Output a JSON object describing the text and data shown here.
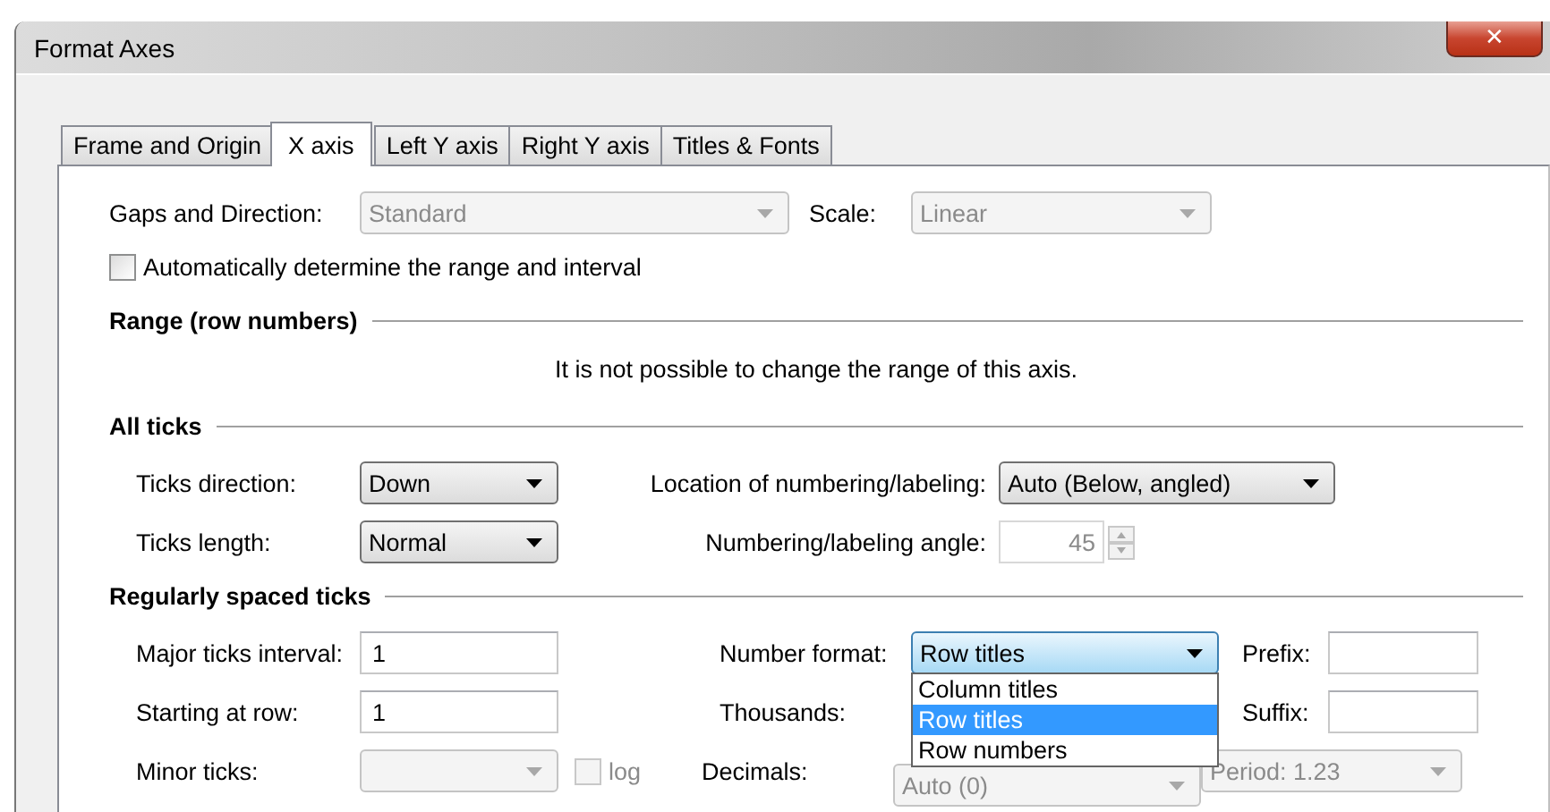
{
  "window": {
    "title": "Format Axes",
    "close": "✕"
  },
  "tabs": [
    {
      "label": "Frame and Origin",
      "selected": false
    },
    {
      "label": "X axis",
      "selected": true
    },
    {
      "label": "Left Y axis",
      "selected": false
    },
    {
      "label": "Right Y axis",
      "selected": false
    },
    {
      "label": "Titles & Fonts",
      "selected": false
    }
  ],
  "gaps_and_direction": {
    "label": "Gaps and Direction:",
    "value": "Standard",
    "disabled": true
  },
  "scale": {
    "label": "Scale:",
    "value": "Linear",
    "disabled": true
  },
  "auto_range": {
    "label": "Automatically determine the range and interval",
    "checked": false
  },
  "range": {
    "heading": "Range (row numbers)",
    "message": "It is not possible to change the range of this axis."
  },
  "all_ticks": {
    "heading": "All ticks",
    "ticks_direction": {
      "label": "Ticks direction:",
      "value": "Down"
    },
    "location": {
      "label": "Location of numbering/labeling:",
      "value": "Auto (Below, angled)"
    },
    "ticks_length": {
      "label": "Ticks length:",
      "value": "Normal"
    },
    "angle": {
      "label": "Numbering/labeling angle:",
      "value": "45",
      "disabled": true
    }
  },
  "regular": {
    "heading": "Regularly spaced ticks",
    "major_interval": {
      "label": "Major ticks interval:",
      "value": "1"
    },
    "number_format": {
      "label": "Number format:",
      "value": "Row titles",
      "expanded": true,
      "options": [
        {
          "label": "Column titles",
          "selected": false
        },
        {
          "label": "Row titles",
          "selected": true
        },
        {
          "label": "Row numbers",
          "selected": false
        }
      ]
    },
    "prefix": {
      "label": "Prefix:"
    },
    "starting_row": {
      "label": "Starting at row:",
      "value": "1"
    },
    "thousands": {
      "label": "Thousands:"
    },
    "suffix": {
      "label": "Suffix:"
    },
    "minor_ticks": {
      "label": "Minor ticks:",
      "disabled": true
    },
    "log": {
      "label": "log",
      "checked": false,
      "disabled": true
    },
    "decimals": {
      "label": "Decimals:",
      "value": "Auto (0)",
      "disabled": true
    },
    "period": {
      "value": "Period: 1.23",
      "disabled": true
    }
  }
}
